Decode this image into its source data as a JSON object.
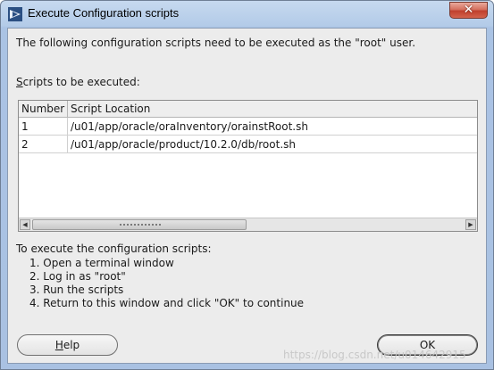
{
  "window": {
    "title": "Execute Configuration scripts",
    "close_glyph": "✕"
  },
  "intro_text": "The following configuration scripts need to be executed as the \"root\" user.",
  "scripts_label": {
    "mnemonic": "S",
    "rest": "cripts to be executed:"
  },
  "table": {
    "columns": [
      "Number",
      "Script Location"
    ],
    "rows": [
      {
        "number": "1",
        "location": "/u01/app/oracle/oraInventory/orainstRoot.sh"
      },
      {
        "number": "2",
        "location": "/u01/app/oracle/product/10.2.0/db/root.sh"
      }
    ]
  },
  "instructions": {
    "heading": "To execute the configuration scripts:",
    "steps": [
      "1. Open a terminal window",
      "2. Log in as \"root\"",
      "3. Run the scripts",
      "4. Return to this window and click \"OK\" to continue"
    ]
  },
  "buttons": {
    "help_mnemonic": "H",
    "help_rest": "elp",
    "ok": "OK"
  },
  "watermark": "https://blog.csdn.net/u014642915",
  "colors": {
    "title_bar": "#b3cbe8",
    "close_button": "#c0402d",
    "client_bg": "#ececec"
  }
}
